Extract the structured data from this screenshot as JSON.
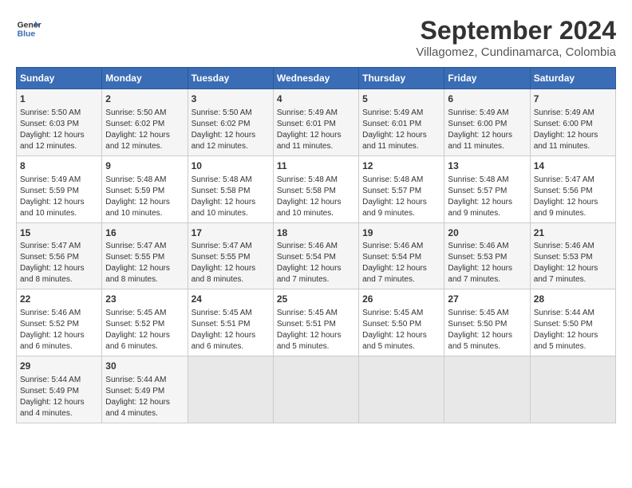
{
  "header": {
    "logo_line1": "General",
    "logo_line2": "Blue",
    "title": "September 2024",
    "subtitle": "Villagomez, Cundinamarca, Colombia"
  },
  "days_of_week": [
    "Sunday",
    "Monday",
    "Tuesday",
    "Wednesday",
    "Thursday",
    "Friday",
    "Saturday"
  ],
  "weeks": [
    [
      {
        "day": "1",
        "sunrise": "5:50 AM",
        "sunset": "6:03 PM",
        "daylight": "12 hours and 12 minutes."
      },
      {
        "day": "2",
        "sunrise": "5:50 AM",
        "sunset": "6:02 PM",
        "daylight": "12 hours and 12 minutes."
      },
      {
        "day": "3",
        "sunrise": "5:50 AM",
        "sunset": "6:02 PM",
        "daylight": "12 hours and 12 minutes."
      },
      {
        "day": "4",
        "sunrise": "5:49 AM",
        "sunset": "6:01 PM",
        "daylight": "12 hours and 11 minutes."
      },
      {
        "day": "5",
        "sunrise": "5:49 AM",
        "sunset": "6:01 PM",
        "daylight": "12 hours and 11 minutes."
      },
      {
        "day": "6",
        "sunrise": "5:49 AM",
        "sunset": "6:00 PM",
        "daylight": "12 hours and 11 minutes."
      },
      {
        "day": "7",
        "sunrise": "5:49 AM",
        "sunset": "6:00 PM",
        "daylight": "12 hours and 11 minutes."
      }
    ],
    [
      {
        "day": "8",
        "sunrise": "5:49 AM",
        "sunset": "5:59 PM",
        "daylight": "12 hours and 10 minutes."
      },
      {
        "day": "9",
        "sunrise": "5:48 AM",
        "sunset": "5:59 PM",
        "daylight": "12 hours and 10 minutes."
      },
      {
        "day": "10",
        "sunrise": "5:48 AM",
        "sunset": "5:58 PM",
        "daylight": "12 hours and 10 minutes."
      },
      {
        "day": "11",
        "sunrise": "5:48 AM",
        "sunset": "5:58 PM",
        "daylight": "12 hours and 10 minutes."
      },
      {
        "day": "12",
        "sunrise": "5:48 AM",
        "sunset": "5:57 PM",
        "daylight": "12 hours and 9 minutes."
      },
      {
        "day": "13",
        "sunrise": "5:48 AM",
        "sunset": "5:57 PM",
        "daylight": "12 hours and 9 minutes."
      },
      {
        "day": "14",
        "sunrise": "5:47 AM",
        "sunset": "5:56 PM",
        "daylight": "12 hours and 9 minutes."
      }
    ],
    [
      {
        "day": "15",
        "sunrise": "5:47 AM",
        "sunset": "5:56 PM",
        "daylight": "12 hours and 8 minutes."
      },
      {
        "day": "16",
        "sunrise": "5:47 AM",
        "sunset": "5:55 PM",
        "daylight": "12 hours and 8 minutes."
      },
      {
        "day": "17",
        "sunrise": "5:47 AM",
        "sunset": "5:55 PM",
        "daylight": "12 hours and 8 minutes."
      },
      {
        "day": "18",
        "sunrise": "5:46 AM",
        "sunset": "5:54 PM",
        "daylight": "12 hours and 7 minutes."
      },
      {
        "day": "19",
        "sunrise": "5:46 AM",
        "sunset": "5:54 PM",
        "daylight": "12 hours and 7 minutes."
      },
      {
        "day": "20",
        "sunrise": "5:46 AM",
        "sunset": "5:53 PM",
        "daylight": "12 hours and 7 minutes."
      },
      {
        "day": "21",
        "sunrise": "5:46 AM",
        "sunset": "5:53 PM",
        "daylight": "12 hours and 7 minutes."
      }
    ],
    [
      {
        "day": "22",
        "sunrise": "5:46 AM",
        "sunset": "5:52 PM",
        "daylight": "12 hours and 6 minutes."
      },
      {
        "day": "23",
        "sunrise": "5:45 AM",
        "sunset": "5:52 PM",
        "daylight": "12 hours and 6 minutes."
      },
      {
        "day": "24",
        "sunrise": "5:45 AM",
        "sunset": "5:51 PM",
        "daylight": "12 hours and 6 minutes."
      },
      {
        "day": "25",
        "sunrise": "5:45 AM",
        "sunset": "5:51 PM",
        "daylight": "12 hours and 5 minutes."
      },
      {
        "day": "26",
        "sunrise": "5:45 AM",
        "sunset": "5:50 PM",
        "daylight": "12 hours and 5 minutes."
      },
      {
        "day": "27",
        "sunrise": "5:45 AM",
        "sunset": "5:50 PM",
        "daylight": "12 hours and 5 minutes."
      },
      {
        "day": "28",
        "sunrise": "5:44 AM",
        "sunset": "5:50 PM",
        "daylight": "12 hours and 5 minutes."
      }
    ],
    [
      {
        "day": "29",
        "sunrise": "5:44 AM",
        "sunset": "5:49 PM",
        "daylight": "12 hours and 4 minutes."
      },
      {
        "day": "30",
        "sunrise": "5:44 AM",
        "sunset": "5:49 PM",
        "daylight": "12 hours and 4 minutes."
      },
      null,
      null,
      null,
      null,
      null
    ]
  ],
  "labels": {
    "sunrise": "Sunrise:",
    "sunset": "Sunset:",
    "daylight": "Daylight:"
  }
}
